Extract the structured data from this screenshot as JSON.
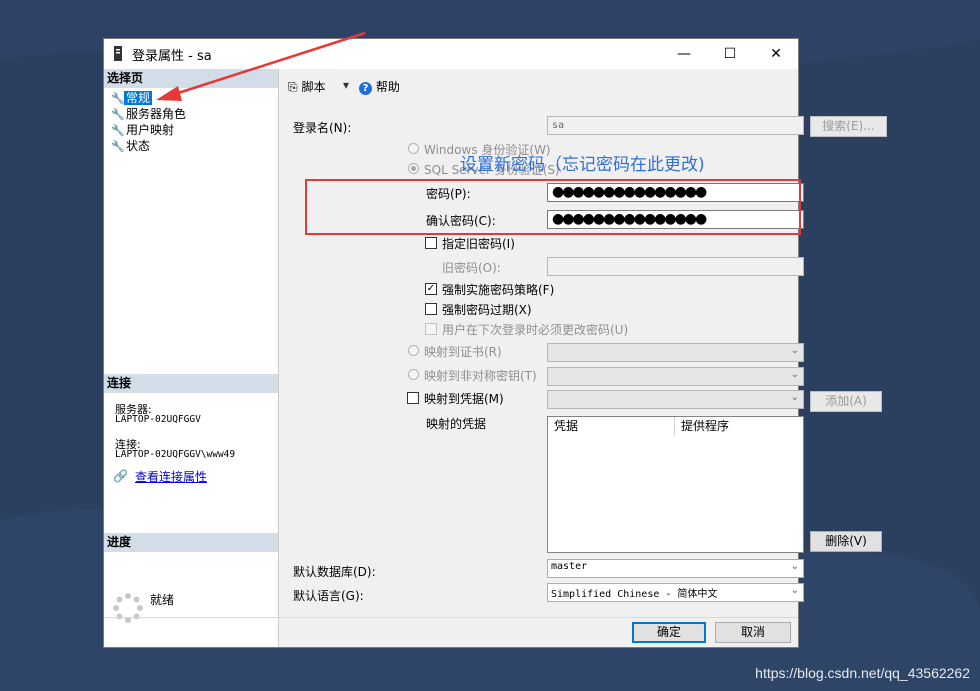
{
  "colors": {
    "desktop": "#2b3f5f",
    "accent": "#0078d7",
    "annotation_red": "#e53935",
    "annotation_blue": "#2f6fd6"
  },
  "window": {
    "title": "登录属性 - sa",
    "minimize": "—",
    "maximize": "☐",
    "close": "✕"
  },
  "left": {
    "select_page_header": "选择页",
    "pages": [
      {
        "label": "常规",
        "selected": true
      },
      {
        "label": "服务器角色"
      },
      {
        "label": "用户映射"
      },
      {
        "label": "状态"
      }
    ],
    "connection_header": "连接",
    "server_label": "服务器:",
    "server_value": "LAPTOP-02UQFGGV",
    "connection_label": "连接:",
    "connection_value": "LAPTOP-02UQFGGV\\www49",
    "view_conn_props": "查看连接属性",
    "progress_header": "进度",
    "progress_status": "就绪"
  },
  "toolbar": {
    "script": "脚本",
    "help": "帮助"
  },
  "form": {
    "login_name_label": "登录名(N):",
    "login_name_value": "sa",
    "search_button": "搜索(E)...",
    "windows_auth": "Windows 身份验证(W)",
    "sql_auth": "SQL Server 身份验证(S)",
    "password_label": "密码(P):",
    "password_value": "●●●●●●●●●●●●●●●",
    "confirm_label": "确认密码(C):",
    "confirm_value": "●●●●●●●●●●●●●●●",
    "specify_old": "指定旧密码(I)",
    "old_password_label": "旧密码(O):",
    "enforce_policy": "强制实施密码策略(F)",
    "enforce_expiration": "强制密码过期(X)",
    "must_change": "用户在下次登录时必须更改密码(U)",
    "map_cert": "映射到证书(R)",
    "map_asym": "映射到非对称密钥(T)",
    "map_credential": "映射到凭据(M)",
    "add_button": "添加(A)",
    "mapped_credentials_label": "映射的凭据",
    "grid_headers": [
      "凭据",
      "提供程序"
    ],
    "remove_button": "删除(V)",
    "default_db_label": "默认数据库(D):",
    "default_db_value": "master",
    "default_lang_label": "默认语言(G):",
    "default_lang_value": "Simplified Chinese - 简体中文"
  },
  "footer": {
    "ok": "确定",
    "cancel": "取消"
  },
  "annotation": {
    "text": "设置新密码（忘记密码在此更改)"
  },
  "watermark": "https://blog.csdn.net/qq_43562262"
}
